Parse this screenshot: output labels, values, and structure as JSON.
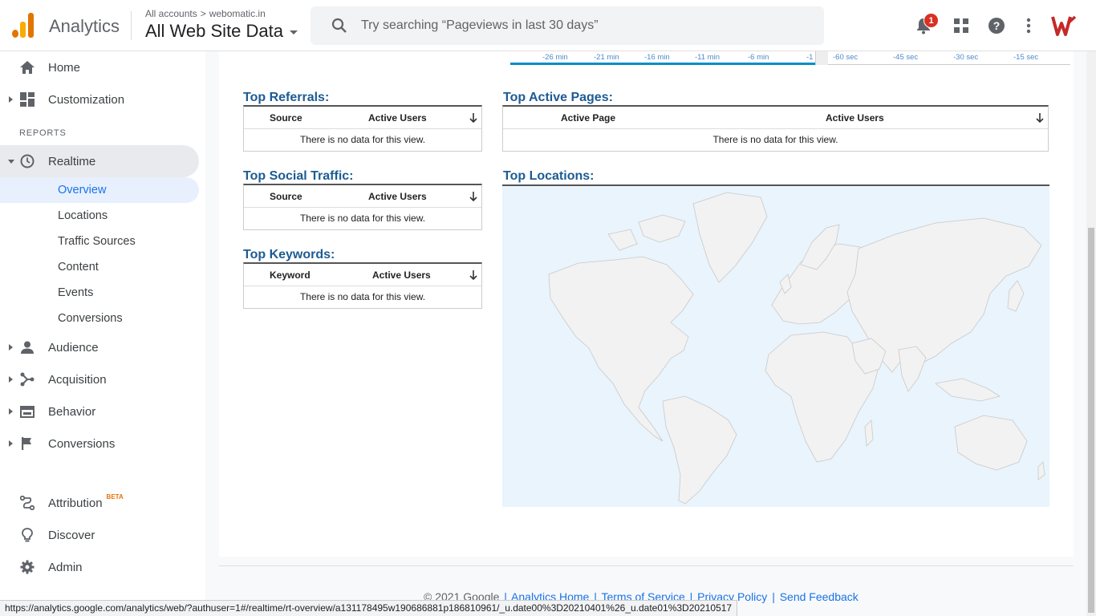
{
  "header": {
    "app_name": "Analytics",
    "breadcrumb_root": "All accounts",
    "breadcrumb_sep": ">",
    "breadcrumb_account": "webomatic.in",
    "property": "All Web Site Data",
    "search_placeholder": "Try searching “Pageviews in last 30 days”",
    "notification_count": "1",
    "icons": [
      "notifications-icon",
      "apps-icon",
      "help-icon",
      "more-vert-icon"
    ],
    "brand_colors": {
      "logo_orange": "#f9ab00",
      "logo_dark": "#e37400",
      "badge_red": "#d93025"
    }
  },
  "sidebar": {
    "home": "Home",
    "customization": "Customization",
    "reports_title": "REPORTS",
    "realtime": "Realtime",
    "realtime_items": [
      "Overview",
      "Locations",
      "Traffic Sources",
      "Content",
      "Events",
      "Conversions"
    ],
    "audience": "Audience",
    "acquisition": "Acquisition",
    "behavior": "Behavior",
    "conversions": "Conversions",
    "attribution": "Attribution",
    "attribution_badge": "BETA",
    "discover": "Discover",
    "admin": "Admin"
  },
  "timeline": {
    "minutes": [
      "-26 min",
      "-21 min",
      "-16 min",
      "-11 min",
      "-6 min",
      "-1"
    ],
    "seconds": [
      "-60 sec",
      "-45 sec",
      "-30 sec",
      "-15 sec"
    ]
  },
  "panels": {
    "referrals": {
      "title": "Top Referrals:",
      "col1": "Source",
      "col2": "Active Users",
      "empty": "There is no data for this view."
    },
    "social": {
      "title": "Top Social Traffic:",
      "col1": "Source",
      "col2": "Active Users",
      "empty": "There is no data for this view."
    },
    "keywords": {
      "title": "Top Keywords:",
      "col1": "Keyword",
      "col2": "Active Users",
      "empty": "There is no data for this view."
    },
    "active_pages": {
      "title": "Top Active Pages:",
      "col1": "Active Page",
      "col2": "Active Users",
      "empty": "There is no data for this view."
    },
    "locations": {
      "title": "Top Locations:"
    }
  },
  "footer": {
    "copyright": "© 2021 Google",
    "links": [
      "Analytics Home",
      "Terms of Service",
      "Privacy Policy",
      "Send Feedback"
    ]
  },
  "status_url": "https://analytics.google.com/analytics/web/?authuser=1#/realtime/rt-overview/a131178495w190686881p186810961/_u.date00%3D20210401%26_u.date01%3D20210517"
}
